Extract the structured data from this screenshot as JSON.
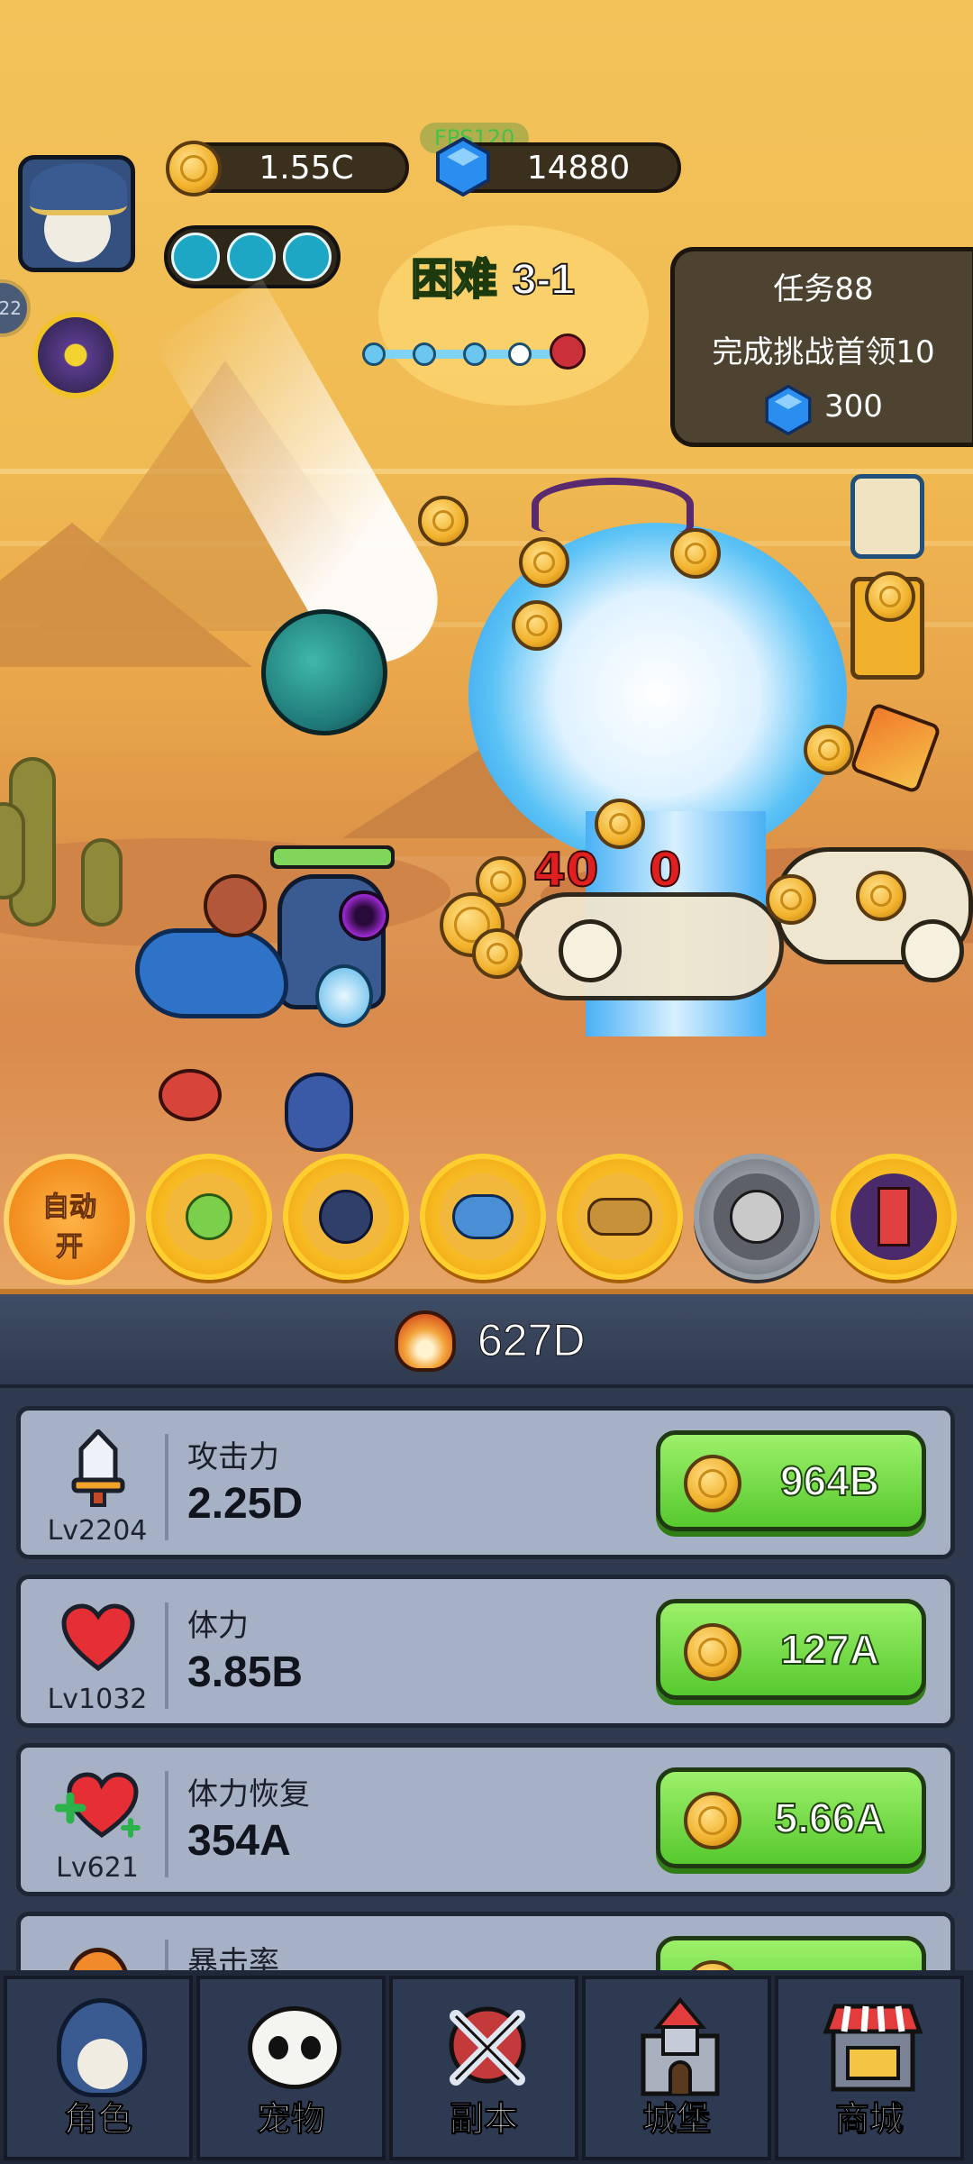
{
  "hud": {
    "gold": "1.55C",
    "gems": "14880",
    "fps": "FPS120",
    "level_badge": "22",
    "stage_label": "困难",
    "stage_number": "3-1"
  },
  "quest": {
    "title": "任务88",
    "description": "完成挑战首领10",
    "reward": "300"
  },
  "battle": {
    "damage_text": "40",
    "damage_suffix": "0"
  },
  "skills": {
    "auto_label_line1": "自动",
    "auto_label_line2": "开"
  },
  "power": {
    "value": "627D"
  },
  "upgrades": [
    {
      "name": "攻击力",
      "level": "Lv2204",
      "value": "2.25D",
      "cost": "964B",
      "icon": "sword-icon"
    },
    {
      "name": "体力",
      "level": "Lv1032",
      "value": "3.85B",
      "cost": "127A",
      "icon": "heart-icon"
    },
    {
      "name": "体力恢复",
      "level": "Lv621",
      "value": "354A",
      "cost": "5.66A",
      "icon": "heart-plus-icon"
    },
    {
      "name": "暴击率",
      "level": "",
      "value": "",
      "cost": "",
      "icon": "flame-icon"
    }
  ],
  "nav": [
    {
      "label": "角色",
      "icon": "hero-icon"
    },
    {
      "label": "宠物",
      "icon": "panda-icon"
    },
    {
      "label": "副本",
      "icon": "crossed-swords-icon"
    },
    {
      "label": "城堡",
      "icon": "castle-icon"
    },
    {
      "label": "商城",
      "icon": "shop-icon"
    }
  ],
  "colors": {
    "accent_green": "#57c92e",
    "gold": "#f1b12b",
    "gem_blue": "#2a8df0",
    "damage_red": "#e02020"
  }
}
